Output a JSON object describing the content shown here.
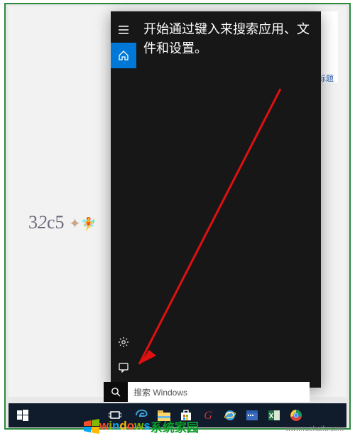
{
  "background": {
    "label_text": "标题"
  },
  "cortana": {
    "prompt_text": "开始通过键入来搜索应用、文件和设置。",
    "sidebar": {
      "menu": "菜单",
      "home": "主页",
      "settings": "设置",
      "feedback": "反馈"
    }
  },
  "search": {
    "placeholder": "搜索 Windows"
  },
  "taskbar": {
    "start": "开始",
    "task_view": "任务视图",
    "edge": "Microsoft Edge",
    "explorer": "文件资源管理器",
    "store": "应用商店",
    "app_g": "应用",
    "ie": "Internet Explorer",
    "calendar": "日历",
    "excel": "Excel",
    "chrome": "Chrome"
  },
  "watermark": {
    "brand_en": "windows",
    "brand_cn": "系统家园",
    "url": "www.ruehaifu.com",
    "logo_colors": {
      "tl": "#f25022",
      "tr": "#7fba00",
      "bl": "#00a4ef",
      "br": "#ffb900"
    }
  }
}
